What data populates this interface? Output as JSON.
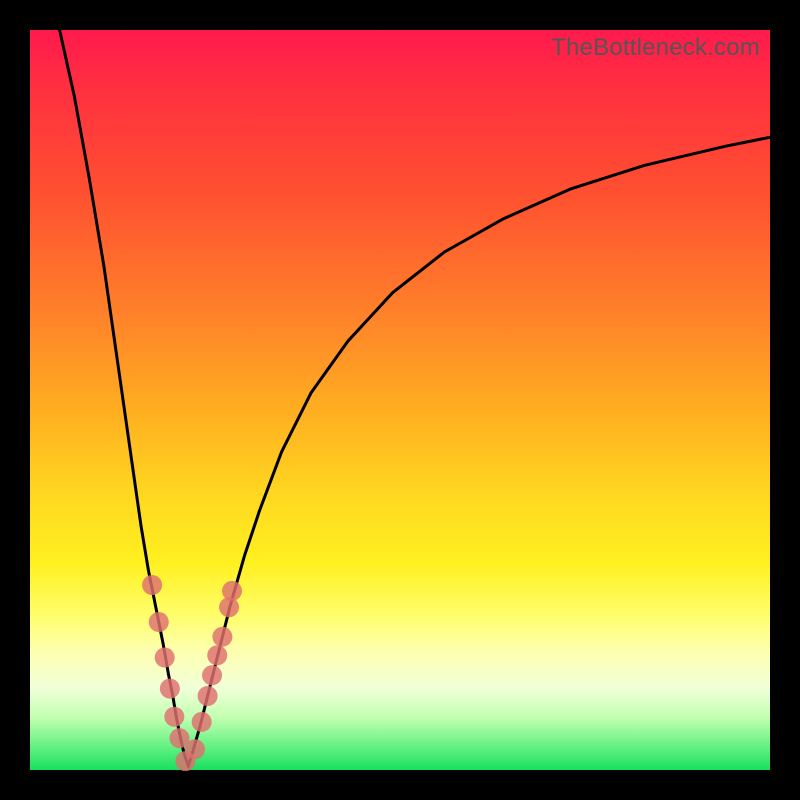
{
  "watermark": "TheBottleneck.com",
  "chart_data": {
    "type": "line",
    "title": "",
    "xlabel": "",
    "ylabel": "",
    "xlim": [
      0,
      100
    ],
    "ylim": [
      0,
      100
    ],
    "note": "Axes are unlabeled in source image; x and y are normalized 0–100. Curve has a sharp V-shaped minimum near x≈21, y≈0, with the left branch rising steeply to top-left and the right branch rising with diminishing slope toward top-right. Marker cluster sits on both branches near the minimum.",
    "series": [
      {
        "name": "left-branch",
        "x": [
          4,
          6,
          8,
          10,
          12,
          14,
          15,
          16,
          17,
          18,
          18.7,
          19.3,
          19.8,
          20.3,
          20.8,
          21.4
        ],
        "y": [
          100,
          91,
          80,
          68,
          54,
          40,
          33,
          27,
          22,
          17,
          13,
          10,
          7,
          4.5,
          2.3,
          0.5
        ]
      },
      {
        "name": "right-branch",
        "x": [
          21.4,
          22,
          23,
          24,
          25,
          26,
          27,
          29,
          31,
          34,
          38,
          43,
          49,
          56,
          64,
          73,
          83,
          94,
          100
        ],
        "y": [
          0.5,
          2.5,
          6,
          10,
          14,
          18,
          22,
          29,
          35,
          43,
          51,
          58,
          64.5,
          70,
          74.5,
          78.5,
          81.7,
          84.3,
          85.5
        ]
      }
    ],
    "markers": {
      "name": "highlight-points",
      "color": "#df6f6f",
      "points": [
        {
          "x": 16.5,
          "y": 25
        },
        {
          "x": 17.4,
          "y": 20
        },
        {
          "x": 18.2,
          "y": 15.2
        },
        {
          "x": 18.9,
          "y": 11
        },
        {
          "x": 19.5,
          "y": 7.2
        },
        {
          "x": 20.2,
          "y": 4.3
        },
        {
          "x": 21.0,
          "y": 1.2
        },
        {
          "x": 22.3,
          "y": 2.8
        },
        {
          "x": 23.2,
          "y": 6.5
        },
        {
          "x": 24.0,
          "y": 10.0
        },
        {
          "x": 24.6,
          "y": 12.8
        },
        {
          "x": 25.3,
          "y": 15.5
        },
        {
          "x": 26.0,
          "y": 18.0
        },
        {
          "x": 26.9,
          "y": 22.0
        },
        {
          "x": 27.3,
          "y": 24.2
        }
      ]
    }
  }
}
